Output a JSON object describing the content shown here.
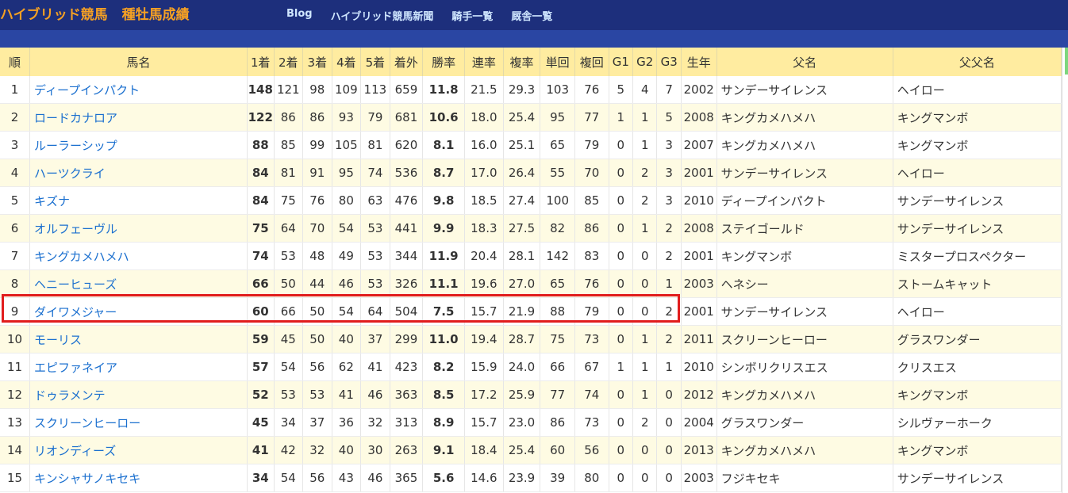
{
  "header": {
    "brand": "ハイブリッド競馬",
    "subtitle": "種牡馬成績",
    "nav": [
      "Blog",
      "ハイブリッド競馬新聞",
      "騎手一覧",
      "厩舎一覧"
    ]
  },
  "colors": {
    "topbar": "#1d2f7c",
    "brand": "#f5a023",
    "header_row": "#ffeca0",
    "highlight": "#e11d1d",
    "link": "#1a6fcf"
  },
  "table": {
    "columns": [
      "順",
      "馬名",
      "1着",
      "2着",
      "3着",
      "4着",
      "5着",
      "着外",
      "勝率",
      "連率",
      "複率",
      "単回",
      "複回",
      "G1",
      "G2",
      "G3",
      "生年",
      "父名",
      "父父名"
    ],
    "rows": [
      [
        "1",
        "ディープインパクト",
        "148",
        "121",
        "98",
        "109",
        "113",
        "659",
        "11.8",
        "21.5",
        "29.3",
        "103",
        "76",
        "5",
        "4",
        "7",
        "2002",
        "サンデーサイレンス",
        "ヘイロー"
      ],
      [
        "2",
        "ロードカナロア",
        "122",
        "86",
        "86",
        "93",
        "79",
        "681",
        "10.6",
        "18.0",
        "25.4",
        "95",
        "77",
        "1",
        "1",
        "5",
        "2008",
        "キングカメハメハ",
        "キングマンボ"
      ],
      [
        "3",
        "ルーラーシップ",
        "88",
        "85",
        "99",
        "105",
        "81",
        "620",
        "8.1",
        "16.0",
        "25.1",
        "65",
        "79",
        "0",
        "1",
        "3",
        "2007",
        "キングカメハメハ",
        "キングマンボ"
      ],
      [
        "4",
        "ハーツクライ",
        "84",
        "81",
        "91",
        "95",
        "74",
        "536",
        "8.7",
        "17.0",
        "26.4",
        "55",
        "70",
        "0",
        "2",
        "3",
        "2001",
        "サンデーサイレンス",
        "ヘイロー"
      ],
      [
        "5",
        "キズナ",
        "84",
        "75",
        "76",
        "80",
        "63",
        "476",
        "9.8",
        "18.5",
        "27.4",
        "100",
        "85",
        "0",
        "2",
        "3",
        "2010",
        "ディープインパクト",
        "サンデーサイレンス"
      ],
      [
        "6",
        "オルフェーヴル",
        "75",
        "64",
        "70",
        "54",
        "53",
        "441",
        "9.9",
        "18.3",
        "27.5",
        "82",
        "86",
        "0",
        "1",
        "2",
        "2008",
        "ステイゴールド",
        "サンデーサイレンス"
      ],
      [
        "7",
        "キングカメハメハ",
        "74",
        "53",
        "48",
        "49",
        "53",
        "344",
        "11.9",
        "20.4",
        "28.1",
        "142",
        "83",
        "0",
        "0",
        "2",
        "2001",
        "キングマンボ",
        "ミスタープロスペクター"
      ],
      [
        "8",
        "ヘニーヒューズ",
        "66",
        "50",
        "44",
        "46",
        "53",
        "326",
        "11.1",
        "19.6",
        "27.0",
        "65",
        "76",
        "0",
        "0",
        "1",
        "2003",
        "ヘネシー",
        "ストームキャット"
      ],
      [
        "9",
        "ダイワメジャー",
        "60",
        "66",
        "50",
        "54",
        "64",
        "504",
        "7.5",
        "15.7",
        "21.9",
        "88",
        "79",
        "0",
        "0",
        "2",
        "2001",
        "サンデーサイレンス",
        "ヘイロー"
      ],
      [
        "10",
        "モーリス",
        "59",
        "45",
        "50",
        "40",
        "37",
        "299",
        "11.0",
        "19.4",
        "28.7",
        "75",
        "73",
        "0",
        "1",
        "2",
        "2011",
        "スクリーンヒーロー",
        "グラスワンダー"
      ],
      [
        "11",
        "エピファネイア",
        "57",
        "54",
        "56",
        "62",
        "41",
        "423",
        "8.2",
        "15.9",
        "24.0",
        "66",
        "67",
        "1",
        "1",
        "1",
        "2010",
        "シンボリクリスエス",
        "クリスエス"
      ],
      [
        "12",
        "ドゥラメンテ",
        "52",
        "53",
        "53",
        "41",
        "46",
        "363",
        "8.5",
        "17.2",
        "25.9",
        "77",
        "74",
        "0",
        "1",
        "0",
        "2012",
        "キングカメハメハ",
        "キングマンボ"
      ],
      [
        "13",
        "スクリーンヒーロー",
        "45",
        "34",
        "37",
        "36",
        "32",
        "313",
        "8.9",
        "15.7",
        "23.0",
        "86",
        "73",
        "0",
        "2",
        "0",
        "2004",
        "グラスワンダー",
        "シルヴァーホーク"
      ],
      [
        "14",
        "リオンディーズ",
        "41",
        "42",
        "32",
        "40",
        "30",
        "263",
        "9.1",
        "18.4",
        "25.4",
        "60",
        "56",
        "0",
        "0",
        "0",
        "2013",
        "キングカメハメハ",
        "キングマンボ"
      ],
      [
        "15",
        "キンシャサノキセキ",
        "34",
        "54",
        "56",
        "43",
        "46",
        "365",
        "5.6",
        "14.6",
        "23.9",
        "39",
        "80",
        "0",
        "0",
        "0",
        "2003",
        "フジキセキ",
        "サンデーサイレンス"
      ]
    ]
  }
}
